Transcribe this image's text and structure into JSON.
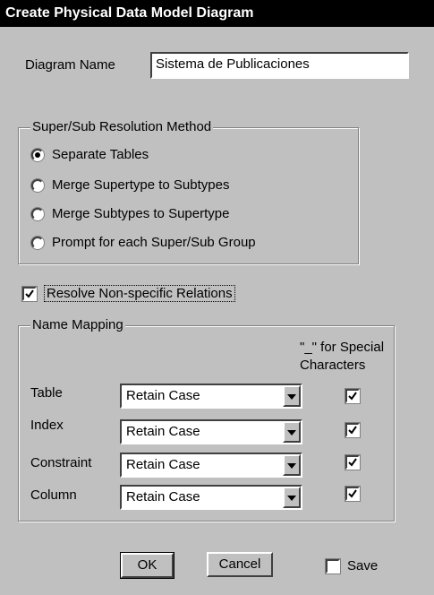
{
  "window": {
    "title": "Create Physical Data Model Diagram"
  },
  "diagram": {
    "label": "Diagram Name",
    "value": "Sistema de Publicaciones"
  },
  "resolution": {
    "title": "Super/Sub Resolution Method",
    "options": [
      {
        "label": "Separate Tables",
        "selected": true
      },
      {
        "label": "Merge Supertype to Subtypes",
        "selected": false
      },
      {
        "label": "Merge Subtypes to Supertype",
        "selected": false
      },
      {
        "label": "Prompt for each Super/Sub Group",
        "selected": false
      }
    ]
  },
  "resolve_nonspecific": {
    "label": "Resolve Non-specific Relations",
    "checked": true
  },
  "name_mapping": {
    "title": "Name Mapping",
    "special_header_line1": "\"_\" for Special",
    "special_header_line2": "Characters",
    "rows": [
      {
        "label": "Table",
        "value": "Retain Case",
        "special": true
      },
      {
        "label": "Index",
        "value": "Retain Case",
        "special": true
      },
      {
        "label": "Constraint",
        "value": "Retain Case",
        "special": true
      },
      {
        "label": "Column",
        "value": "Retain Case",
        "special": true
      }
    ]
  },
  "buttons": {
    "ok": "OK",
    "cancel": "Cancel"
  },
  "save": {
    "label": "Save",
    "checked": false
  }
}
